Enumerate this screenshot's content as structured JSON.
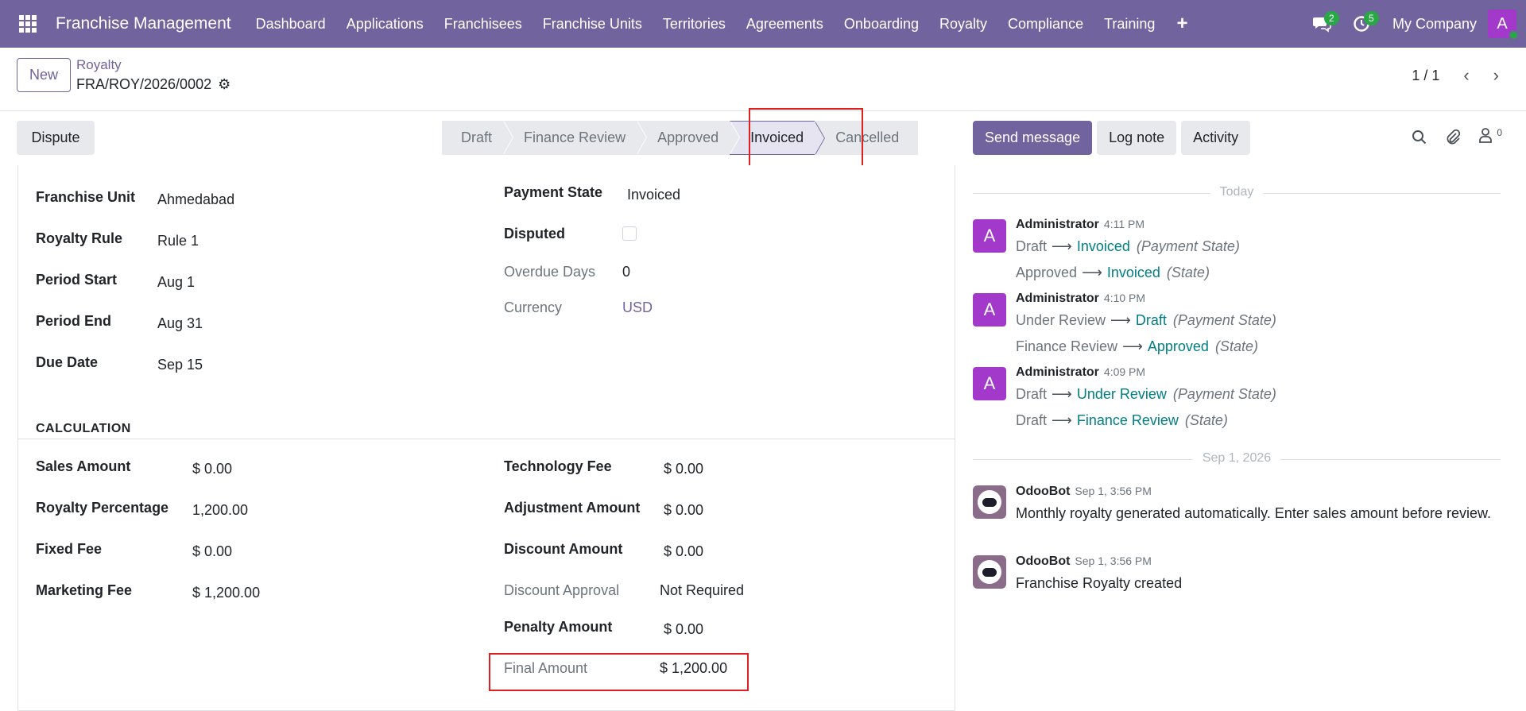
{
  "navbar": {
    "brand": "Franchise Management",
    "menu": [
      "Dashboard",
      "Applications",
      "Franchisees",
      "Franchise Units",
      "Territories",
      "Agreements",
      "Onboarding",
      "Royalty",
      "Compliance",
      "Training"
    ],
    "plus": "+",
    "messages_count": "2",
    "activities_count": "5",
    "company": "My Company",
    "user_initial": "A"
  },
  "control": {
    "new_label": "New",
    "breadcrumb_parent": "Royalty",
    "breadcrumb_current": "FRA/ROY/2026/0002",
    "pager": "1 / 1"
  },
  "statusbar": {
    "dispute_label": "Dispute",
    "stages": [
      "Draft",
      "Finance Review",
      "Approved",
      "Invoiced",
      "Cancelled"
    ],
    "active_stage": "Invoiced"
  },
  "chatter_buttons": {
    "send_message": "Send message",
    "log_note": "Log note",
    "activity": "Activity",
    "followers_count": "0"
  },
  "form": {
    "top_left": [
      {
        "label": "Franchise Unit",
        "value": "Ahmedabad"
      },
      {
        "label": "Royalty Rule",
        "value": "Rule 1"
      },
      {
        "label": "Period Start",
        "value": "Aug 1"
      },
      {
        "label": "Period End",
        "value": "Aug 31"
      },
      {
        "label": "Due Date",
        "value": "Sep 15"
      }
    ],
    "top_right": {
      "payment_state_label": "Payment State",
      "payment_state_value": "Invoiced",
      "disputed_label": "Disputed",
      "disputed_checked": false,
      "overdue_label": "Overdue Days",
      "overdue_value": "0",
      "currency_label": "Currency",
      "currency_value": "USD"
    },
    "calc_title": "CALCULATION",
    "calc_left": [
      {
        "label": "Sales Amount",
        "value": "$ 0.00"
      },
      {
        "label": "Royalty Percentage",
        "value": "1,200.00"
      },
      {
        "label": "Fixed Fee",
        "value": "$ 0.00"
      },
      {
        "label": "Marketing Fee",
        "value": "$ 1,200.00"
      }
    ],
    "calc_right": [
      {
        "label": "Technology Fee",
        "value": "$ 0.00"
      },
      {
        "label": "Adjustment Amount",
        "value": "$ 0.00"
      },
      {
        "label": "Discount Amount",
        "value": "$ 0.00"
      },
      {
        "label": "Discount Approval",
        "value": "Not Required"
      },
      {
        "label": "Penalty Amount",
        "value": "$ 0.00"
      },
      {
        "label": "Final Amount",
        "value": "$ 1,200.00"
      }
    ]
  },
  "chatter": {
    "today": "Today",
    "date2": "Sep 1, 2026",
    "messages": [
      {
        "author": "Administrator",
        "time": "4:11 PM",
        "initial": "A",
        "tracks": [
          {
            "old": "Draft",
            "new": "Invoiced",
            "field": "(Payment State)"
          },
          {
            "old": "Approved",
            "new": "Invoiced",
            "field": "(State)"
          }
        ]
      },
      {
        "author": "Administrator",
        "time": "4:10 PM",
        "initial": "A",
        "tracks": [
          {
            "old": "Under Review",
            "new": "Draft",
            "field": "(Payment State)"
          },
          {
            "old": "Finance Review",
            "new": "Approved",
            "field": "(State)"
          }
        ]
      },
      {
        "author": "Administrator",
        "time": "4:09 PM",
        "initial": "A",
        "tracks": [
          {
            "old": "Draft",
            "new": "Under Review",
            "field": "(Payment State)"
          },
          {
            "old": "Draft",
            "new": "Finance Review",
            "field": "(State)"
          }
        ]
      }
    ],
    "bot_messages": [
      {
        "author": "OdooBot",
        "time": "Sep 1, 3:56 PM",
        "body": "Monthly royalty generated automatically. Enter sales amount before review."
      },
      {
        "author": "OdooBot",
        "time": "Sep 1, 3:56 PM",
        "body": "Franchise Royalty created"
      }
    ]
  }
}
